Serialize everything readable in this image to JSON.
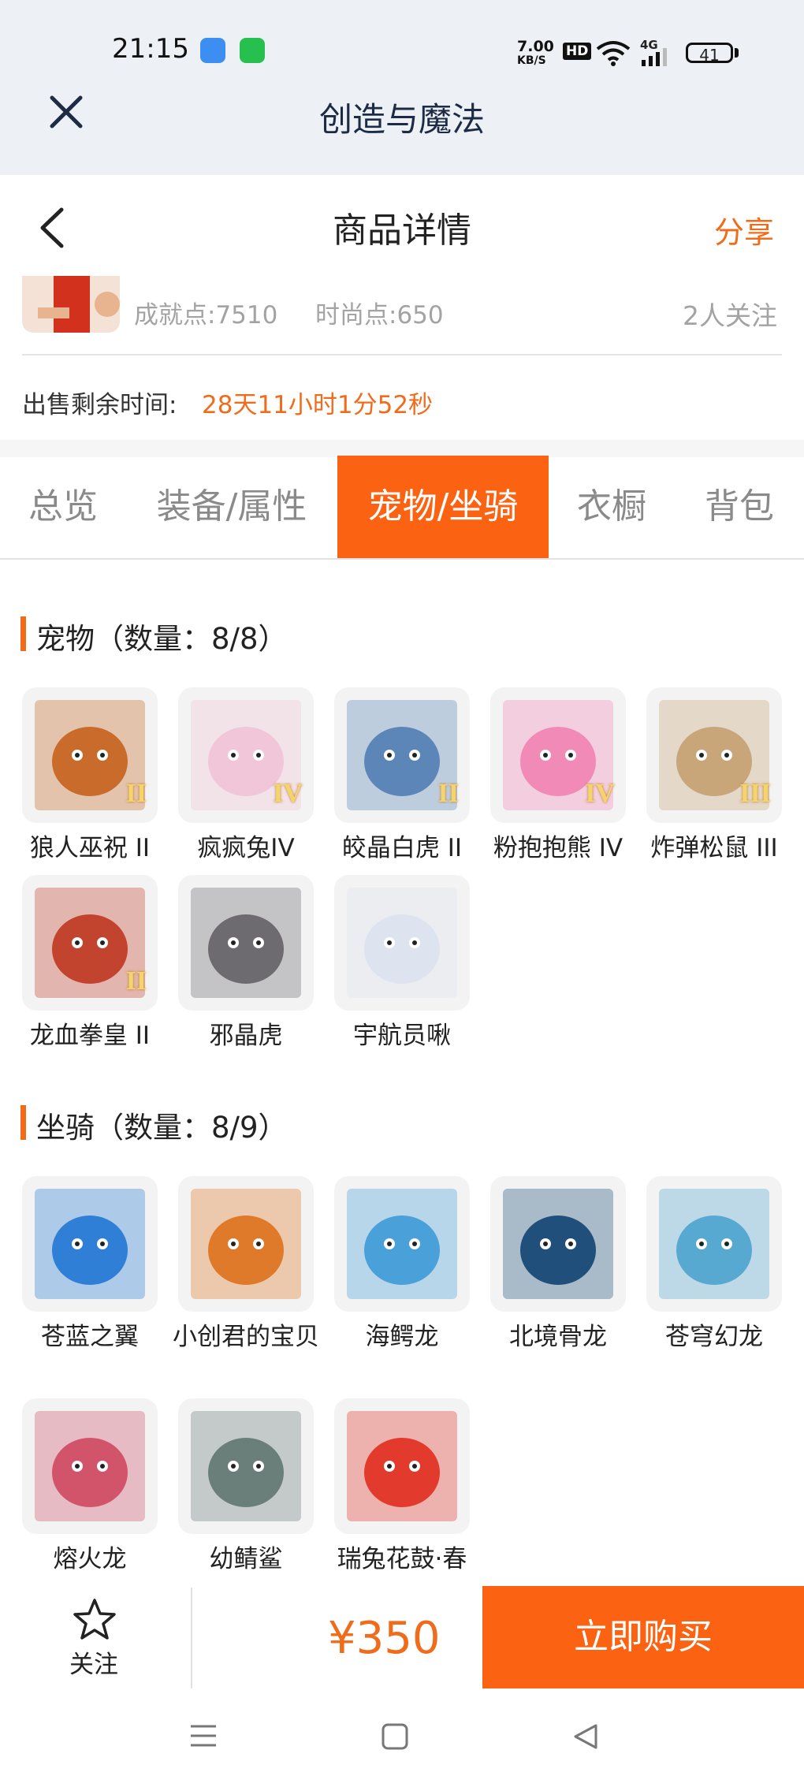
{
  "status_bar": {
    "time": "21:15",
    "net_speed": "7.00",
    "net_unit": "KB/S",
    "hd": "HD",
    "signal": "4G",
    "battery": "41"
  },
  "window": {
    "title": "创造与魔法",
    "close_icon": "close-icon"
  },
  "header": {
    "title": "商品详情",
    "share": "分享",
    "back_icon": "back-arrow-icon"
  },
  "summary": {
    "achievement": "成就点:7510",
    "fashion": "时尚点:650",
    "followers": "2人关注",
    "remaining_label": "出售剩余时间:",
    "remaining_value": "28天11小时1分52秒"
  },
  "tabs": [
    {
      "label": "总览",
      "active": false
    },
    {
      "label": "装备/属性",
      "active": false
    },
    {
      "label": "宠物/坐骑",
      "active": true
    },
    {
      "label": "衣橱",
      "active": false
    },
    {
      "label": "背包",
      "active": false
    }
  ],
  "pets": {
    "title": "宠物（数量：8/8）",
    "items": [
      {
        "name": "狼人巫祝 II",
        "grade": "II",
        "color": "#c96b2a"
      },
      {
        "name": "疯疯兔IV",
        "grade": "IV",
        "color": "#f1c6d8"
      },
      {
        "name": "皎晶白虎 II",
        "grade": "II",
        "color": "#5d86b8"
      },
      {
        "name": "粉抱抱熊 IV",
        "grade": "IV",
        "color": "#f28ab8"
      },
      {
        "name": "炸弹松鼠 III",
        "grade": "III",
        "color": "#c9a57a"
      },
      {
        "name": "龙血拳皇 II",
        "grade": "II",
        "color": "#c2442e"
      },
      {
        "name": "邪晶虎",
        "grade": "",
        "color": "#6d6a70"
      },
      {
        "name": "宇航员啾",
        "grade": "",
        "color": "#dde3ef"
      }
    ]
  },
  "mounts": {
    "title": "坐骑（数量：8/9）",
    "items": [
      {
        "name": "苍蓝之翼",
        "color": "#2f7fd6"
      },
      {
        "name": "小创君的宝贝",
        "color": "#e07a2b"
      },
      {
        "name": "海鳄龙",
        "color": "#4aa0d8"
      },
      {
        "name": "北境骨龙",
        "color": "#1f4f7a"
      },
      {
        "name": "苍穹幻龙",
        "color": "#58a9d2"
      },
      {
        "name": "熔火龙",
        "color": "#d2546a"
      },
      {
        "name": "幼鲭鲨",
        "color": "#6b7f7a"
      },
      {
        "name": "瑞兔花鼓·春",
        "color": "#e23a2c"
      }
    ]
  },
  "bottom": {
    "follow_label": "关注",
    "price": "¥350",
    "buy_label": "立即购买"
  }
}
